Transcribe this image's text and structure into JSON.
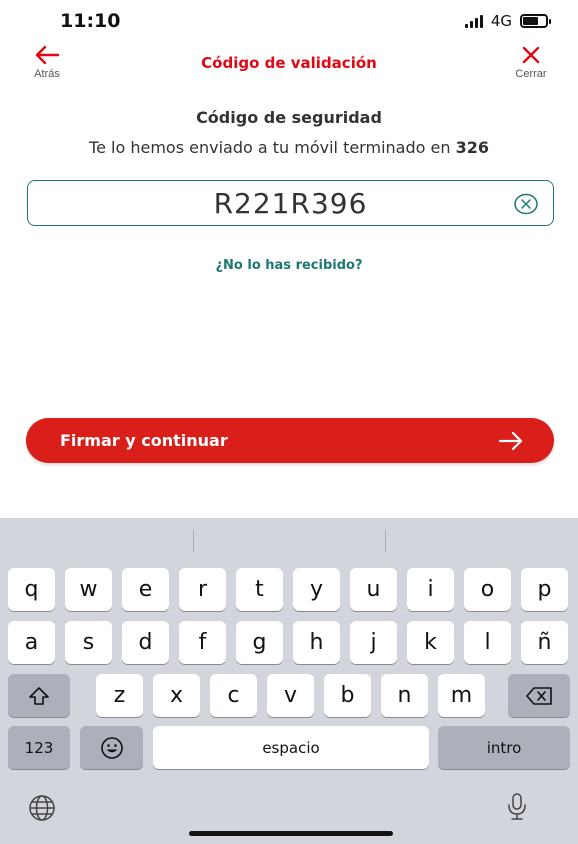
{
  "status_bar": {
    "time": "11:10",
    "network": "4G"
  },
  "header": {
    "back_label": "Atrás",
    "title": "Código de validación",
    "close_label": "Cerrar"
  },
  "content": {
    "section_title": "Código de seguridad",
    "description_prefix": "Te lo hemos enviado a tu móvil terminado en",
    "phone_suffix": "326",
    "code_value": "R221R396",
    "resend_link": "¿No lo has recibido?",
    "primary_button": "Firmar y continuar"
  },
  "colors": {
    "brand_red": "#e30613",
    "button_red": "#da1f1b",
    "teal": "#1d7874"
  },
  "keyboard": {
    "row1": [
      "q",
      "w",
      "e",
      "r",
      "t",
      "y",
      "u",
      "i",
      "o",
      "p"
    ],
    "row2": [
      "a",
      "s",
      "d",
      "f",
      "g",
      "h",
      "j",
      "k",
      "l",
      "ñ"
    ],
    "row3": [
      "z",
      "x",
      "c",
      "v",
      "b",
      "n",
      "m"
    ],
    "numbers_key": "123",
    "space_key": "espacio",
    "return_key": "intro",
    "icons": [
      "shift-icon",
      "backspace-icon",
      "emoji-icon",
      "globe-icon",
      "microphone-icon"
    ]
  }
}
